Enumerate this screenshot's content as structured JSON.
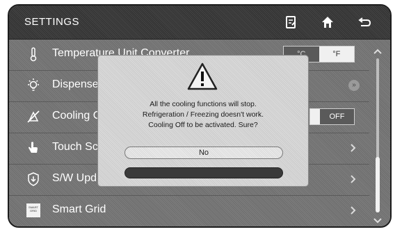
{
  "header": {
    "title": "SETTINGS",
    "icons": [
      "memo-icon",
      "home-icon",
      "back-icon"
    ]
  },
  "settings": {
    "items": [
      {
        "label": "Temperature Unit Converter",
        "icon": "thermometer-icon",
        "control": "unit-toggle"
      },
      {
        "label": "Dispense",
        "icon": "lightbulb-icon",
        "control": "info"
      },
      {
        "label": "Cooling Off",
        "icon": "cooling-off-icon",
        "control": "off-toggle"
      },
      {
        "label": "Touch Sc",
        "icon": "touch-hand-icon",
        "control": "chevron"
      },
      {
        "label": "S/W Upd",
        "icon": "shield-icon",
        "control": "chevron"
      },
      {
        "label": "Smart Grid",
        "icon": "smart-grid-icon",
        "control": "chevron"
      }
    ],
    "unit_toggle": {
      "celsius": "°C",
      "fahrenheit": "°F",
      "selected": "°F"
    },
    "cooling_toggle": {
      "state": "OFF"
    },
    "smart_grid_icon_text": "SMART GRID"
  },
  "dialog": {
    "message_lines": [
      "All the cooling functions will stop.",
      "Refrigeration / Freezing doesn't work.",
      "Cooling Off to be activated. Sure?"
    ],
    "no_label": "No",
    "yes_label": ""
  },
  "colors": {
    "screen_bg": "#7a7a7a",
    "topbar_bg": "#3c3c3c",
    "dialog_bg": "#d6d6d6",
    "text_light": "#ffffff"
  }
}
